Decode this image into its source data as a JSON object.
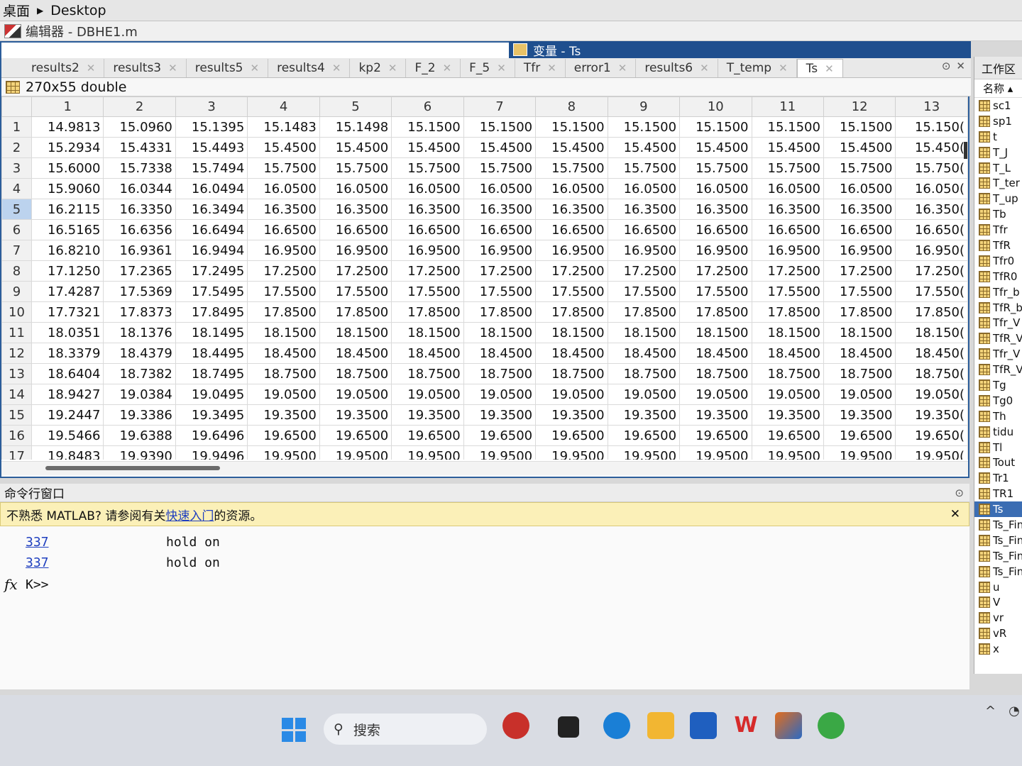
{
  "breadcrumb": {
    "root": "桌面",
    "current": "Desktop"
  },
  "editor": {
    "title": "编辑器 - DBHE1.m"
  },
  "variable_window": {
    "title": "变量 - Ts",
    "size_label": "270x55 double",
    "tabs": [
      {
        "label": "results2"
      },
      {
        "label": "results3"
      },
      {
        "label": "results5"
      },
      {
        "label": "results4"
      },
      {
        "label": "kp2"
      },
      {
        "label": "F_2"
      },
      {
        "label": "F_5"
      },
      {
        "label": "Tfr"
      },
      {
        "label": "error1"
      },
      {
        "label": "results6"
      },
      {
        "label": "T_temp"
      },
      {
        "label": "Ts"
      }
    ],
    "active_tab": "Ts",
    "columns": [
      "1",
      "2",
      "3",
      "4",
      "5",
      "6",
      "7",
      "8",
      "9",
      "10",
      "11",
      "12",
      "13"
    ],
    "rows": [
      {
        "id": "1",
        "cells": [
          "14.9813",
          "15.0960",
          "15.1395",
          "15.1483",
          "15.1498",
          "15.1500",
          "15.1500",
          "15.1500",
          "15.1500",
          "15.1500",
          "15.1500",
          "15.1500",
          "15.150("
        ]
      },
      {
        "id": "2",
        "cells": [
          "15.2934",
          "15.4331",
          "15.4493",
          "15.4500",
          "15.4500",
          "15.4500",
          "15.4500",
          "15.4500",
          "15.4500",
          "15.4500",
          "15.4500",
          "15.4500",
          "15.450("
        ]
      },
      {
        "id": "3",
        "cells": [
          "15.6000",
          "15.7338",
          "15.7494",
          "15.7500",
          "15.7500",
          "15.7500",
          "15.7500",
          "15.7500",
          "15.7500",
          "15.7500",
          "15.7500",
          "15.7500",
          "15.750("
        ]
      },
      {
        "id": "4",
        "cells": [
          "15.9060",
          "16.0344",
          "16.0494",
          "16.0500",
          "16.0500",
          "16.0500",
          "16.0500",
          "16.0500",
          "16.0500",
          "16.0500",
          "16.0500",
          "16.0500",
          "16.050("
        ]
      },
      {
        "id": "5",
        "cells": [
          "16.2115",
          "16.3350",
          "16.3494",
          "16.3500",
          "16.3500",
          "16.3500",
          "16.3500",
          "16.3500",
          "16.3500",
          "16.3500",
          "16.3500",
          "16.3500",
          "16.350("
        ]
      },
      {
        "id": "6",
        "cells": [
          "16.5165",
          "16.6356",
          "16.6494",
          "16.6500",
          "16.6500",
          "16.6500",
          "16.6500",
          "16.6500",
          "16.6500",
          "16.6500",
          "16.6500",
          "16.6500",
          "16.650("
        ]
      },
      {
        "id": "7",
        "cells": [
          "16.8210",
          "16.9361",
          "16.9494",
          "16.9500",
          "16.9500",
          "16.9500",
          "16.9500",
          "16.9500",
          "16.9500",
          "16.9500",
          "16.9500",
          "16.9500",
          "16.950("
        ]
      },
      {
        "id": "8",
        "cells": [
          "17.1250",
          "17.2365",
          "17.2495",
          "17.2500",
          "17.2500",
          "17.2500",
          "17.2500",
          "17.2500",
          "17.2500",
          "17.2500",
          "17.2500",
          "17.2500",
          "17.250("
        ]
      },
      {
        "id": "9",
        "cells": [
          "17.4287",
          "17.5369",
          "17.5495",
          "17.5500",
          "17.5500",
          "17.5500",
          "17.5500",
          "17.5500",
          "17.5500",
          "17.5500",
          "17.5500",
          "17.5500",
          "17.550("
        ]
      },
      {
        "id": "10",
        "cells": [
          "17.7321",
          "17.8373",
          "17.8495",
          "17.8500",
          "17.8500",
          "17.8500",
          "17.8500",
          "17.8500",
          "17.8500",
          "17.8500",
          "17.8500",
          "17.8500",
          "17.850("
        ]
      },
      {
        "id": "11",
        "cells": [
          "18.0351",
          "18.1376",
          "18.1495",
          "18.1500",
          "18.1500",
          "18.1500",
          "18.1500",
          "18.1500",
          "18.1500",
          "18.1500",
          "18.1500",
          "18.1500",
          "18.150("
        ]
      },
      {
        "id": "12",
        "cells": [
          "18.3379",
          "18.4379",
          "18.4495",
          "18.4500",
          "18.4500",
          "18.4500",
          "18.4500",
          "18.4500",
          "18.4500",
          "18.4500",
          "18.4500",
          "18.4500",
          "18.450("
        ]
      },
      {
        "id": "13",
        "cells": [
          "18.6404",
          "18.7382",
          "18.7495",
          "18.7500",
          "18.7500",
          "18.7500",
          "18.7500",
          "18.7500",
          "18.7500",
          "18.7500",
          "18.7500",
          "18.7500",
          "18.750("
        ]
      },
      {
        "id": "14",
        "cells": [
          "18.9427",
          "19.0384",
          "19.0495",
          "19.0500",
          "19.0500",
          "19.0500",
          "19.0500",
          "19.0500",
          "19.0500",
          "19.0500",
          "19.0500",
          "19.0500",
          "19.050("
        ]
      },
      {
        "id": "15",
        "cells": [
          "19.2447",
          "19.3386",
          "19.3495",
          "19.3500",
          "19.3500",
          "19.3500",
          "19.3500",
          "19.3500",
          "19.3500",
          "19.3500",
          "19.3500",
          "19.3500",
          "19.350("
        ]
      },
      {
        "id": "16",
        "cells": [
          "19.5466",
          "19.6388",
          "19.6496",
          "19.6500",
          "19.6500",
          "19.6500",
          "19.6500",
          "19.6500",
          "19.6500",
          "19.6500",
          "19.6500",
          "19.6500",
          "19.650("
        ]
      },
      {
        "id": "17",
        "cells": [
          "19.8483",
          "19.9390",
          "19.9496",
          "19.9500",
          "19.9500",
          "19.9500",
          "19.9500",
          "19.9500",
          "19.9500",
          "19.9500",
          "19.9500",
          "19.9500",
          "19.950("
        ]
      }
    ],
    "selected_row": "5"
  },
  "workspace": {
    "title": "工作区",
    "name_header": "名称 ▴",
    "items": [
      "sc1",
      "sp1",
      "t",
      "T_J",
      "T_L",
      "T_ter",
      "T_up",
      "Tb",
      "Tfr",
      "TfR",
      "Tfr0",
      "TfR0",
      "Tfr_b",
      "TfR_b",
      "Tfr_V",
      "TfR_V",
      "Tfr_V",
      "TfR_V",
      "Tg",
      "Tg0",
      "Th",
      "tidu",
      "Tl",
      "Tout",
      "Tr1",
      "TR1",
      "Ts",
      "Ts_Fin",
      "Ts_Fin",
      "Ts_Fin",
      "Ts_Fin",
      "u",
      "V",
      "vr",
      "vR",
      "x"
    ],
    "selected": "Ts"
  },
  "command_window": {
    "title": "命令行窗口",
    "notice_prefix": "不熟悉 MATLAB? 请参阅有关",
    "notice_link": "快速入门",
    "notice_suffix": "的资源。",
    "lines": [
      {
        "link": "337",
        "text": "hold on"
      },
      {
        "link": "337",
        "text": "hold on"
      }
    ],
    "prompt": "K>>"
  },
  "taskbar": {
    "search_placeholder": "搜索"
  },
  "colors": {
    "accent": "#1f4f8e",
    "selection": "#3b6db3",
    "notice_bg": "#fbf0b8"
  }
}
